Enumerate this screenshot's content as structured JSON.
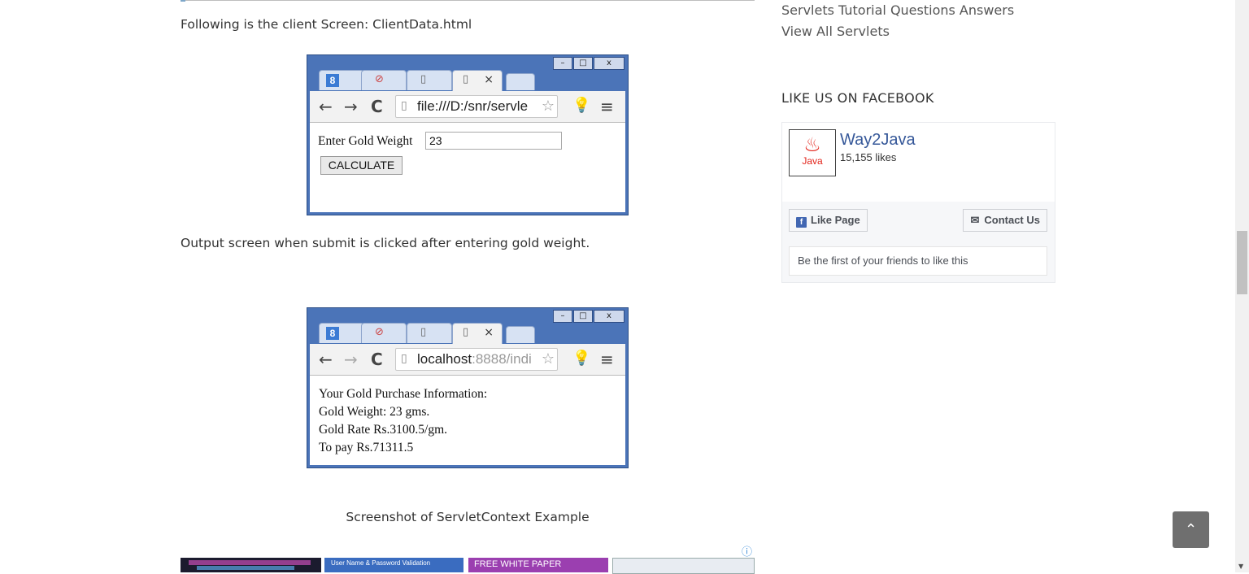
{
  "main": {
    "client_screen_text": "Following is the client Screen: ClientData.html",
    "output_screen_text": "Output screen when submit is clicked after entering gold weight.",
    "caption": "Screenshot of ServletContext Example"
  },
  "shot1": {
    "url": "file:///D:/snr/servle",
    "input_label": "Enter Gold Weight",
    "input_value": "23",
    "button_label": "CALCULATE",
    "win_min": "–",
    "win_max": "□",
    "win_close": "x"
  },
  "shot2": {
    "url_host": "localhost",
    "url_rest": ":8888/indi",
    "lines": [
      "Your Gold Purchase Information:",
      "Gold Weight: 23 gms.",
      "Gold Rate Rs.3100.5/gm.",
      "To pay Rs.71311.5"
    ]
  },
  "sidebar": {
    "links": [
      "Servlets Tutorial Questions Answers",
      "View All Servlets"
    ],
    "facebook_heading": "LIKE US ON FACEBOOK",
    "fb_page_name": "Way2Java",
    "fb_likes": "15,155 likes",
    "fb_logo_text": "Java",
    "like_page_label": "Like Page",
    "contact_label": "Contact Us",
    "friends_text": "Be the first of your friends to like this"
  },
  "ads": {
    "ad2_text": "User Name & Password Validation",
    "ad3_text": "FREE WHITE PAPER"
  },
  "icons": {
    "back_to_top": "chevron-up-icon"
  },
  "colors": {
    "fb_blue": "#365899",
    "browser_frame": "#4b74b8"
  }
}
